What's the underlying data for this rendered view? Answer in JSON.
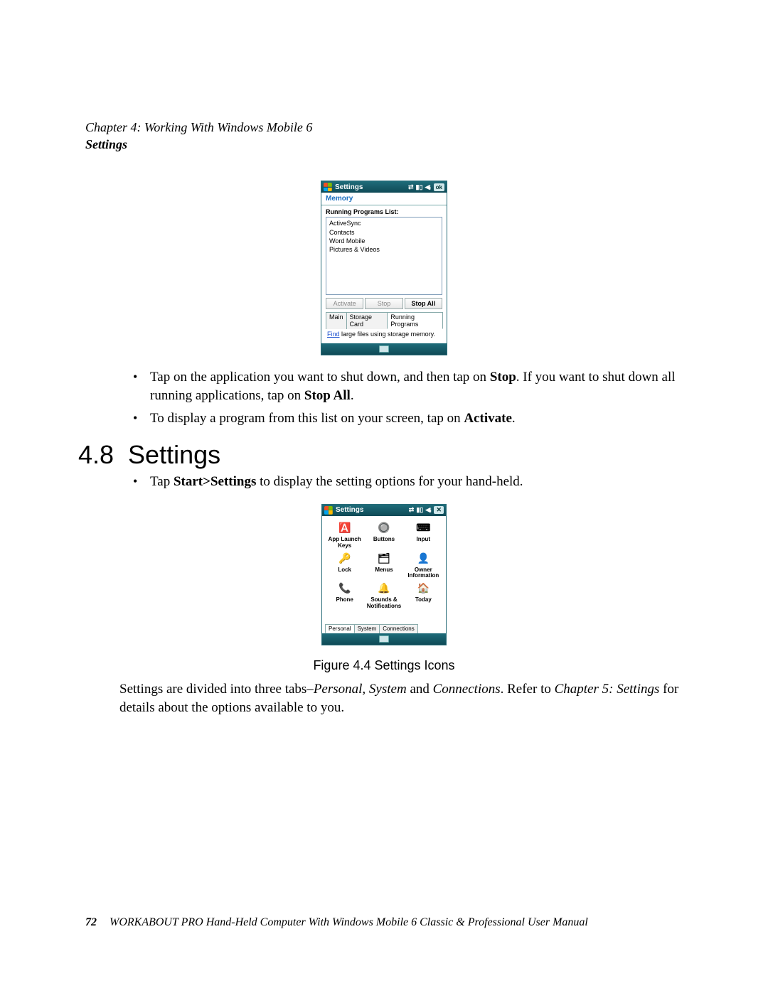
{
  "header": {
    "chapter": "Chapter  4:  Working With Windows Mobile 6",
    "section": "Settings"
  },
  "screenshot1": {
    "title": "Settings",
    "ok_label": "ok",
    "subtab": "Memory",
    "list_label": "Running Programs List:",
    "programs": [
      "ActiveSync",
      "Contacts",
      "Word Mobile",
      "Pictures & Videos"
    ],
    "buttons": {
      "activate": "Activate",
      "stop": "Stop",
      "stop_all": "Stop All"
    },
    "tabs": [
      "Main",
      "Storage Card",
      "Running Programs"
    ],
    "active_tab_index": 2,
    "hint_link": "Find",
    "hint_rest": " large files using storage memory."
  },
  "bullets1": [
    {
      "pre": "Tap on the application you want to shut down, and then tap on ",
      "b1": "Stop",
      "mid": ". If you want to shut down all running applications, tap on ",
      "b2": "Stop All",
      "post": "."
    },
    {
      "pre": "To display a program from this list on your screen, tap on ",
      "b1": "Activate",
      "mid": ".",
      "b2": "",
      "post": ""
    }
  ],
  "section": {
    "number": "4.8",
    "title": "Settings"
  },
  "bullet_settings": {
    "pre": "Tap ",
    "b": "Start>Settings",
    "post": " to display the setting options for your hand-held."
  },
  "screenshot2": {
    "title": "Settings",
    "x_label": "✕",
    "apps": [
      {
        "label": "App Launch Keys",
        "icon": "🅰️",
        "color": "#2a6fbf"
      },
      {
        "label": "Buttons",
        "icon": "🔘",
        "color": "#4a90d9"
      },
      {
        "label": "Input",
        "icon": "⌨",
        "color": "#c0b090"
      },
      {
        "label": "Lock",
        "icon": "🔑",
        "color": "#e0a030"
      },
      {
        "label": "Menus",
        "icon": "🗂",
        "color": "#5a8fd0"
      },
      {
        "label": "Owner Information",
        "icon": "👤",
        "color": "#d07030"
      },
      {
        "label": "Phone",
        "icon": "📞",
        "color": "#3a80c0"
      },
      {
        "label": "Sounds & Notifications",
        "icon": "🔔",
        "color": "#c09040"
      },
      {
        "label": "Today",
        "icon": "🏠",
        "color": "#d08030"
      }
    ],
    "tabs": [
      "Personal",
      "System",
      "Connections"
    ],
    "active_tab_index": 0
  },
  "figure_caption": "Figure 4.4  Settings Icons",
  "closing": {
    "pre": "Settings are divided into three tabs–",
    "i1": "Personal, System",
    "mid1": " and ",
    "i2": "Connections",
    "mid2": ". Refer to ",
    "i3": "Chapter 5: Settings",
    "post": " for details about the options available to you."
  },
  "footer": {
    "page": "72",
    "title": "WORKABOUT PRO Hand-Held Computer With Windows Mobile 6 Classic & Professional User Manual"
  }
}
